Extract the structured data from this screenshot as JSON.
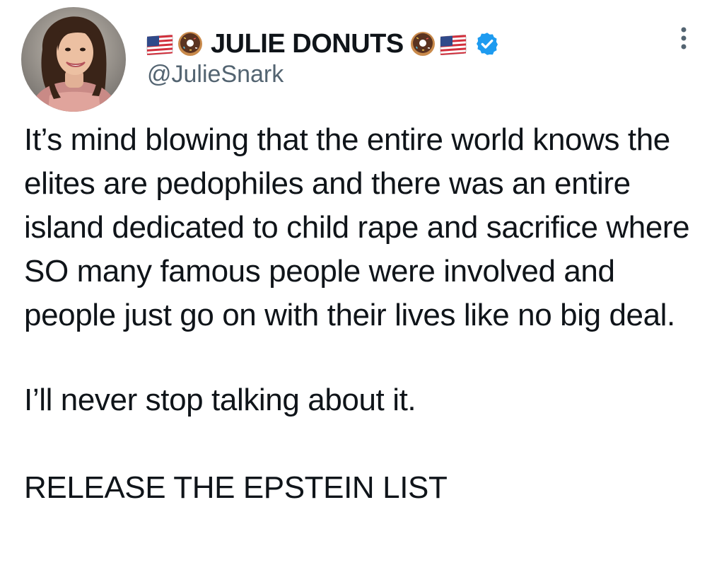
{
  "author": {
    "display_name": "JULIE DONUTS",
    "handle": "@JulieSnark",
    "verified": true,
    "name_emojis_left": [
      "flag-us-icon",
      "donut-icon"
    ],
    "name_emojis_right": [
      "donut-icon",
      "flag-us-icon"
    ]
  },
  "tweet": {
    "paragraphs": [
      "It’s mind blowing that the entire world knows the elites are pedophiles and there was an entire island dedicated to child rape and sacrifice where SO many famous people were involved and people just go on with their lives like no big deal.",
      "I’ll never stop talking about it.",
      "RELEASE THE EPSTEIN LIST"
    ]
  },
  "colors": {
    "text": "#0f1419",
    "secondary": "#536471",
    "verified_badge": "#1d9bf0",
    "background": "#ffffff"
  }
}
